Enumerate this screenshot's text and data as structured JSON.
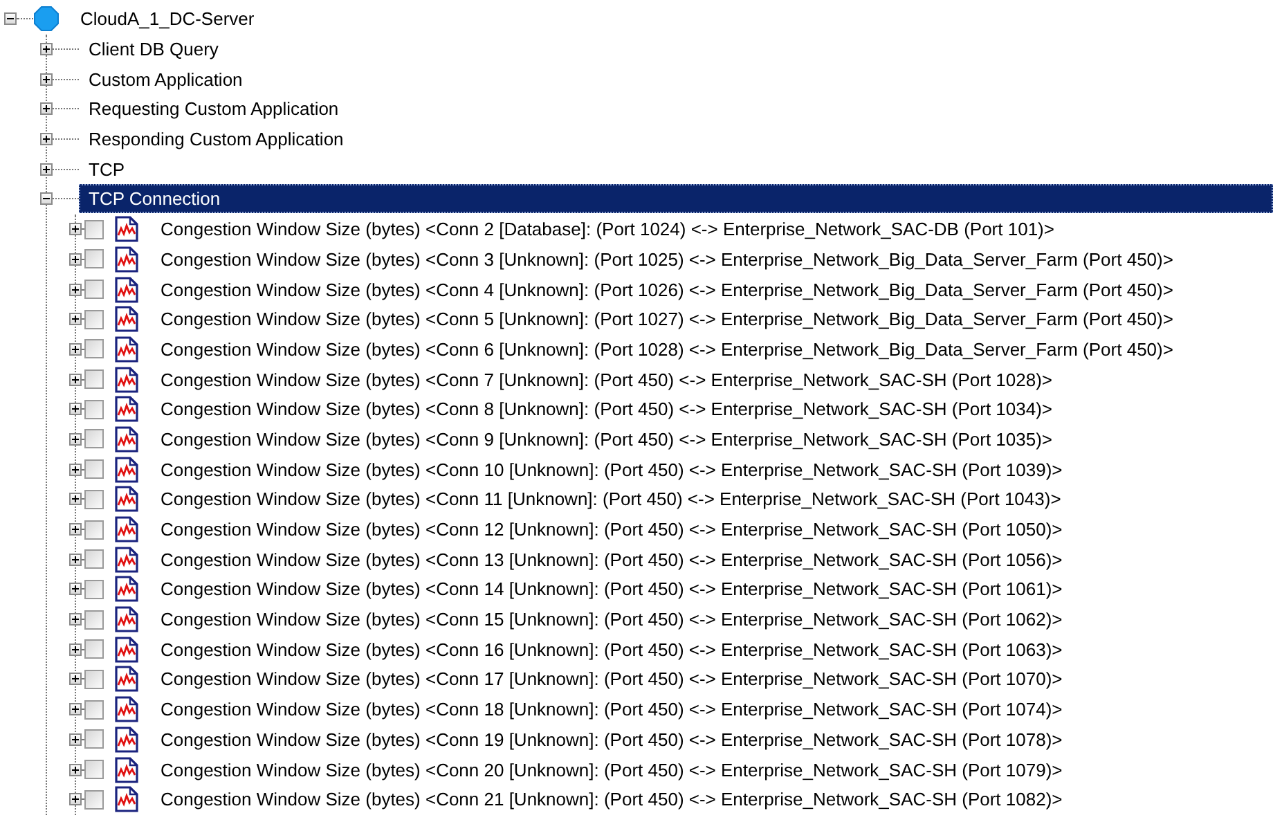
{
  "tree": {
    "label": "CloudA_1_DC-Server",
    "expanded": true,
    "selected": false,
    "children": [
      {
        "label": "Client DB Query",
        "expanded": false,
        "selected": false
      },
      {
        "label": "Custom Application",
        "expanded": false,
        "selected": false
      },
      {
        "label": "Requesting Custom Application",
        "expanded": false,
        "selected": false
      },
      {
        "label": "Responding Custom Application",
        "expanded": false,
        "selected": false
      },
      {
        "label": "TCP",
        "expanded": false,
        "selected": false
      },
      {
        "label": "TCP Connection",
        "expanded": true,
        "selected": true,
        "children": [
          {
            "label": "Congestion Window Size (bytes) <Conn 2 [Database]: (Port 1024) <-> Enterprise_Network_SAC-DB (Port 101)>",
            "expanded": false,
            "selected": false,
            "checked": false
          },
          {
            "label": "Congestion Window Size (bytes) <Conn 3 [Unknown]: (Port 1025) <-> Enterprise_Network_Big_Data_Server_Farm (Port 450)>",
            "expanded": false,
            "selected": false,
            "checked": false
          },
          {
            "label": "Congestion Window Size (bytes) <Conn 4 [Unknown]: (Port 1026) <-> Enterprise_Network_Big_Data_Server_Farm (Port 450)>",
            "expanded": false,
            "selected": false,
            "checked": false
          },
          {
            "label": "Congestion Window Size (bytes) <Conn 5 [Unknown]: (Port 1027) <-> Enterprise_Network_Big_Data_Server_Farm (Port 450)>",
            "expanded": false,
            "selected": false,
            "checked": false
          },
          {
            "label": "Congestion Window Size (bytes) <Conn 6 [Unknown]: (Port 1028) <-> Enterprise_Network_Big_Data_Server_Farm (Port 450)>",
            "expanded": false,
            "selected": false,
            "checked": false
          },
          {
            "label": "Congestion Window Size (bytes) <Conn 7 [Unknown]: (Port 450) <-> Enterprise_Network_SAC-SH (Port 1028)>",
            "expanded": false,
            "selected": false,
            "checked": false
          },
          {
            "label": "Congestion Window Size (bytes) <Conn 8 [Unknown]: (Port 450) <-> Enterprise_Network_SAC-SH (Port 1034)>",
            "expanded": false,
            "selected": false,
            "checked": false
          },
          {
            "label": "Congestion Window Size (bytes) <Conn 9 [Unknown]: (Port 450) <-> Enterprise_Network_SAC-SH (Port 1035)>",
            "expanded": false,
            "selected": false,
            "checked": false
          },
          {
            "label": "Congestion Window Size (bytes) <Conn 10 [Unknown]: (Port 450) <-> Enterprise_Network_SAC-SH (Port 1039)>",
            "expanded": false,
            "selected": false,
            "checked": false
          },
          {
            "label": "Congestion Window Size (bytes) <Conn 11 [Unknown]: (Port 450) <-> Enterprise_Network_SAC-SH (Port 1043)>",
            "expanded": false,
            "selected": false,
            "checked": false
          },
          {
            "label": "Congestion Window Size (bytes) <Conn 12 [Unknown]: (Port 450) <-> Enterprise_Network_SAC-SH (Port 1050)>",
            "expanded": false,
            "selected": false,
            "checked": false
          },
          {
            "label": "Congestion Window Size (bytes) <Conn 13 [Unknown]: (Port 450) <-> Enterprise_Network_SAC-SH (Port 1056)>",
            "expanded": false,
            "selected": false,
            "checked": false
          },
          {
            "label": "Congestion Window Size (bytes) <Conn 14 [Unknown]: (Port 450) <-> Enterprise_Network_SAC-SH (Port 1061)>",
            "expanded": false,
            "selected": false,
            "checked": false
          },
          {
            "label": "Congestion Window Size (bytes) <Conn 15 [Unknown]: (Port 450) <-> Enterprise_Network_SAC-SH (Port 1062)>",
            "expanded": false,
            "selected": false,
            "checked": false
          },
          {
            "label": "Congestion Window Size (bytes) <Conn 16 [Unknown]: (Port 450) <-> Enterprise_Network_SAC-SH (Port 1063)>",
            "expanded": false,
            "selected": false,
            "checked": false
          },
          {
            "label": "Congestion Window Size (bytes) <Conn 17 [Unknown]: (Port 450) <-> Enterprise_Network_SAC-SH (Port 1070)>",
            "expanded": false,
            "selected": false,
            "checked": false
          },
          {
            "label": "Congestion Window Size (bytes) <Conn 18 [Unknown]: (Port 450) <-> Enterprise_Network_SAC-SH (Port 1074)>",
            "expanded": false,
            "selected": false,
            "checked": false
          },
          {
            "label": "Congestion Window Size (bytes) <Conn 19 [Unknown]: (Port 450) <-> Enterprise_Network_SAC-SH (Port 1078)>",
            "expanded": false,
            "selected": false,
            "checked": false
          },
          {
            "label": "Congestion Window Size (bytes) <Conn 20 [Unknown]: (Port 450) <-> Enterprise_Network_SAC-SH (Port 1079)>",
            "expanded": false,
            "selected": false,
            "checked": false
          },
          {
            "label": "Congestion Window Size (bytes) <Conn 21 [Unknown]: (Port 450) <-> Enterprise_Network_SAC-SH (Port 1082)>",
            "expanded": false,
            "selected": false,
            "checked": false
          }
        ]
      }
    ]
  }
}
